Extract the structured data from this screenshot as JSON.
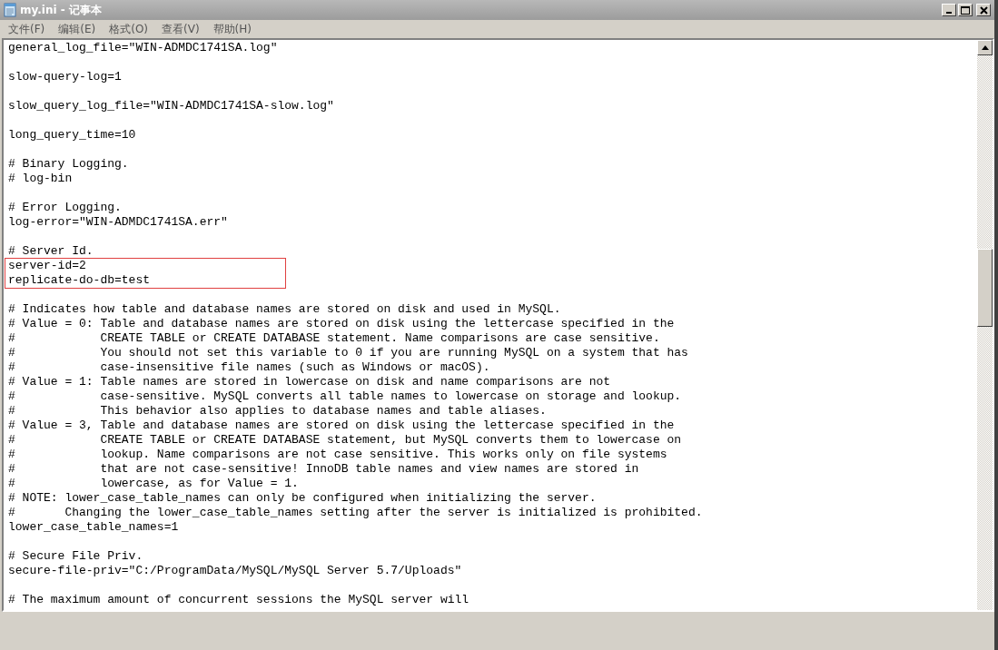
{
  "window": {
    "title": "my.ini - 记事本"
  },
  "menu": [
    "文件(F)",
    "编辑(E)",
    "格式(O)",
    "查看(V)",
    "帮助(H)"
  ],
  "lines_before": [
    {
      "kind": "text",
      "text": "general_log_file=\"WIN-ADMDC1741SA.log\""
    },
    {
      "kind": "blank"
    },
    {
      "kind": "text",
      "text": "slow-query-log=1"
    },
    {
      "kind": "blank"
    },
    {
      "kind": "text",
      "text": "slow_query_log_file=\"WIN-ADMDC1741SA-slow.log\""
    },
    {
      "kind": "blank"
    },
    {
      "kind": "text",
      "text": "long_query_time=10"
    },
    {
      "kind": "blank"
    },
    {
      "kind": "text",
      "text": "# Binary Logging."
    },
    {
      "kind": "text",
      "text": "# log-bin"
    },
    {
      "kind": "blank"
    },
    {
      "kind": "text",
      "text": "# Error Logging."
    },
    {
      "kind": "text",
      "text": "log-error=\"WIN-ADMDC1741SA.err\""
    },
    {
      "kind": "blank"
    },
    {
      "kind": "text",
      "text": "# Server Id."
    }
  ],
  "boxed_lines": [
    "server-id=2",
    "replicate-do-db=test"
  ],
  "lines_after": [
    {
      "kind": "blank"
    },
    {
      "kind": "text",
      "text": "# Indicates how table and database names are stored on disk and used in MySQL."
    },
    {
      "kind": "text",
      "text": "# Value = 0: Table and database names are stored on disk using the lettercase specified in the"
    },
    {
      "kind": "text",
      "text": "#            CREATE TABLE or CREATE DATABASE statement. Name comparisons are case sensitive."
    },
    {
      "kind": "text",
      "text": "#            You should not set this variable to 0 if you are running MySQL on a system that has"
    },
    {
      "kind": "text",
      "text": "#            case-insensitive file names (such as Windows or macOS)."
    },
    {
      "kind": "text",
      "text": "# Value = 1: Table names are stored in lowercase on disk and name comparisons are not"
    },
    {
      "kind": "text",
      "text": "#            case-sensitive. MySQL converts all table names to lowercase on storage and lookup."
    },
    {
      "kind": "text",
      "text": "#            This behavior also applies to database names and table aliases."
    },
    {
      "kind": "text",
      "text": "# Value = 3, Table and database names are stored on disk using the lettercase specified in the"
    },
    {
      "kind": "text",
      "text": "#            CREATE TABLE or CREATE DATABASE statement, but MySQL converts them to lowercase on"
    },
    {
      "kind": "text",
      "text": "#            lookup. Name comparisons are not case sensitive. This works only on file systems"
    },
    {
      "kind": "text",
      "text": "#            that are not case-sensitive! InnoDB table names and view names are stored in"
    },
    {
      "kind": "text",
      "text": "#            lowercase, as for Value = 1."
    },
    {
      "kind": "text",
      "text": "# NOTE: lower_case_table_names can only be configured when initializing the server."
    },
    {
      "kind": "text",
      "text": "#       Changing the lower_case_table_names setting after the server is initialized is prohibited."
    },
    {
      "kind": "text",
      "text": "lower_case_table_names=1"
    },
    {
      "kind": "blank"
    },
    {
      "kind": "text",
      "text": "# Secure File Priv."
    },
    {
      "kind": "text",
      "text": "secure-file-priv=\"C:/ProgramData/MySQL/MySQL Server 5.7/Uploads\""
    },
    {
      "kind": "blank"
    },
    {
      "kind": "text",
      "text": "# The maximum amount of concurrent sessions the MySQL server will"
    }
  ]
}
